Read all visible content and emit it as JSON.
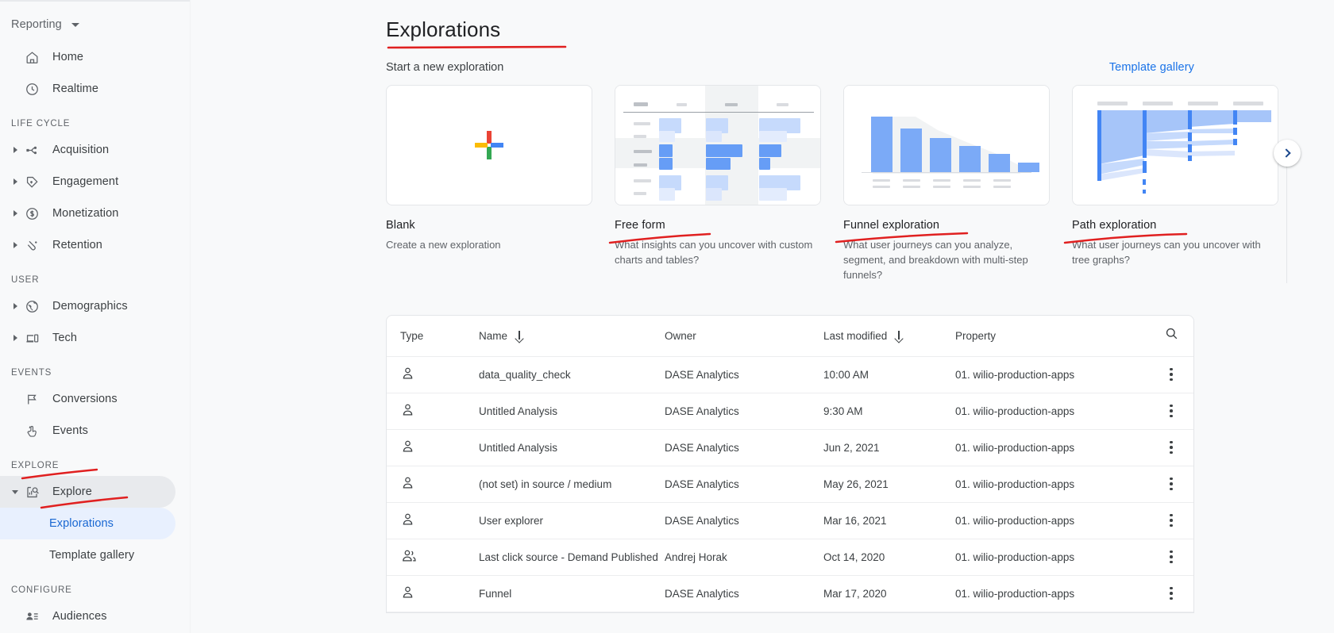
{
  "sidebar": {
    "reporting_label": "Reporting",
    "items": [
      {
        "label": "Home",
        "icon": "home-icon",
        "expandable": false
      },
      {
        "label": "Realtime",
        "icon": "clock-icon",
        "expandable": false
      }
    ],
    "sections": [
      {
        "title": "LIFE CYCLE",
        "items": [
          {
            "label": "Acquisition",
            "icon": "acquisition-icon",
            "expandable": true
          },
          {
            "label": "Engagement",
            "icon": "tag-icon",
            "expandable": true
          },
          {
            "label": "Monetization",
            "icon": "dollar-icon",
            "expandable": true
          },
          {
            "label": "Retention",
            "icon": "retention-icon",
            "expandable": true
          }
        ]
      },
      {
        "title": "USER",
        "items": [
          {
            "label": "Demographics",
            "icon": "globe-icon",
            "expandable": true
          },
          {
            "label": "Tech",
            "icon": "devices-icon",
            "expandable": true
          }
        ]
      },
      {
        "title": "EVENTS",
        "items": [
          {
            "label": "Conversions",
            "icon": "flag-icon",
            "expandable": false
          },
          {
            "label": "Events",
            "icon": "tap-icon",
            "expandable": false
          }
        ]
      },
      {
        "title": "EXPLORE",
        "items": [
          {
            "label": "Explore",
            "icon": "explore-icon",
            "expandable": true,
            "expanded": true,
            "state": "active-parent"
          },
          {
            "label": "Explorations",
            "icon": "",
            "sub": true,
            "state": "active-child"
          },
          {
            "label": "Template gallery",
            "icon": "",
            "sub": true
          }
        ]
      },
      {
        "title": "CONFIGURE",
        "items": [
          {
            "label": "Audiences",
            "icon": "audiences-icon",
            "expandable": false
          }
        ]
      }
    ]
  },
  "header": {
    "title": "Explorations",
    "subhead": "Start a new exploration",
    "template_gallery_link": "Template gallery"
  },
  "cards": [
    {
      "name": "Blank",
      "desc": "Create a new exploration",
      "thumb": "blank-plus"
    },
    {
      "name": "Free form",
      "desc": "What insights can you uncover with custom charts and tables?",
      "thumb": "free-form-table"
    },
    {
      "name": "Funnel exploration",
      "desc": "What user journeys can you analyze, segment, and breakdown with multi-step funnels?",
      "thumb": "funnel-bars"
    },
    {
      "name": "Path exploration",
      "desc": "What user journeys can you uncover with tree graphs?",
      "thumb": "path-sankey"
    }
  ],
  "table": {
    "columns": [
      {
        "label": "Type",
        "sortable": false
      },
      {
        "label": "Name",
        "sortable": true
      },
      {
        "label": "Owner",
        "sortable": false
      },
      {
        "label": "Last modified",
        "sortable": true
      },
      {
        "label": "Property",
        "sortable": false
      }
    ],
    "search_icon": "search-icon",
    "rows": [
      {
        "type_icon": "person-icon",
        "name": "data_quality_check",
        "owner": "DASE Analytics",
        "modified": "10:00 AM",
        "property": "01. wilio-production-apps"
      },
      {
        "type_icon": "person-icon",
        "name": "Untitled Analysis",
        "owner": "DASE Analytics",
        "modified": "9:30 AM",
        "property": "01. wilio-production-apps"
      },
      {
        "type_icon": "person-icon",
        "name": "Untitled Analysis",
        "owner": "DASE Analytics",
        "modified": "Jun 2, 2021",
        "property": "01. wilio-production-apps"
      },
      {
        "type_icon": "person-icon",
        "name": "(not set) in source / medium",
        "owner": "DASE Analytics",
        "modified": "May 26, 2021",
        "property": "01. wilio-production-apps"
      },
      {
        "type_icon": "person-icon",
        "name": "User explorer",
        "owner": "DASE Analytics",
        "modified": "Mar 16, 2021",
        "property": "01. wilio-production-apps"
      },
      {
        "type_icon": "people-shared-icon",
        "name": "Last click source - Demand Published",
        "owner": "Andrej Horak",
        "modified": "Oct 14, 2020",
        "property": "01. wilio-production-apps"
      },
      {
        "type_icon": "person-icon",
        "name": "Funnel",
        "owner": "DASE Analytics",
        "modified": "Mar 17, 2020",
        "property": "01. wilio-production-apps"
      }
    ]
  },
  "carousel": {
    "next_icon": "chevron-right-icon"
  },
  "annotations": {
    "color": "#e02020",
    "marks": [
      "underline-explorations-title",
      "underline-free-form",
      "underline-funnel-exploration",
      "underline-path-exploration",
      "underline-sidebar-explore",
      "underline-sidebar-explorations"
    ]
  },
  "colors": {
    "accent_blue": "#1a73e8",
    "active_child_bg": "#e8f0fe",
    "active_parent_bg": "#e8eaed",
    "chart_blue": "#7baaf7",
    "chart_blue_strong": "#4285f4",
    "page_bg": "#f8f9fa",
    "annotation_red": "#e02020"
  }
}
